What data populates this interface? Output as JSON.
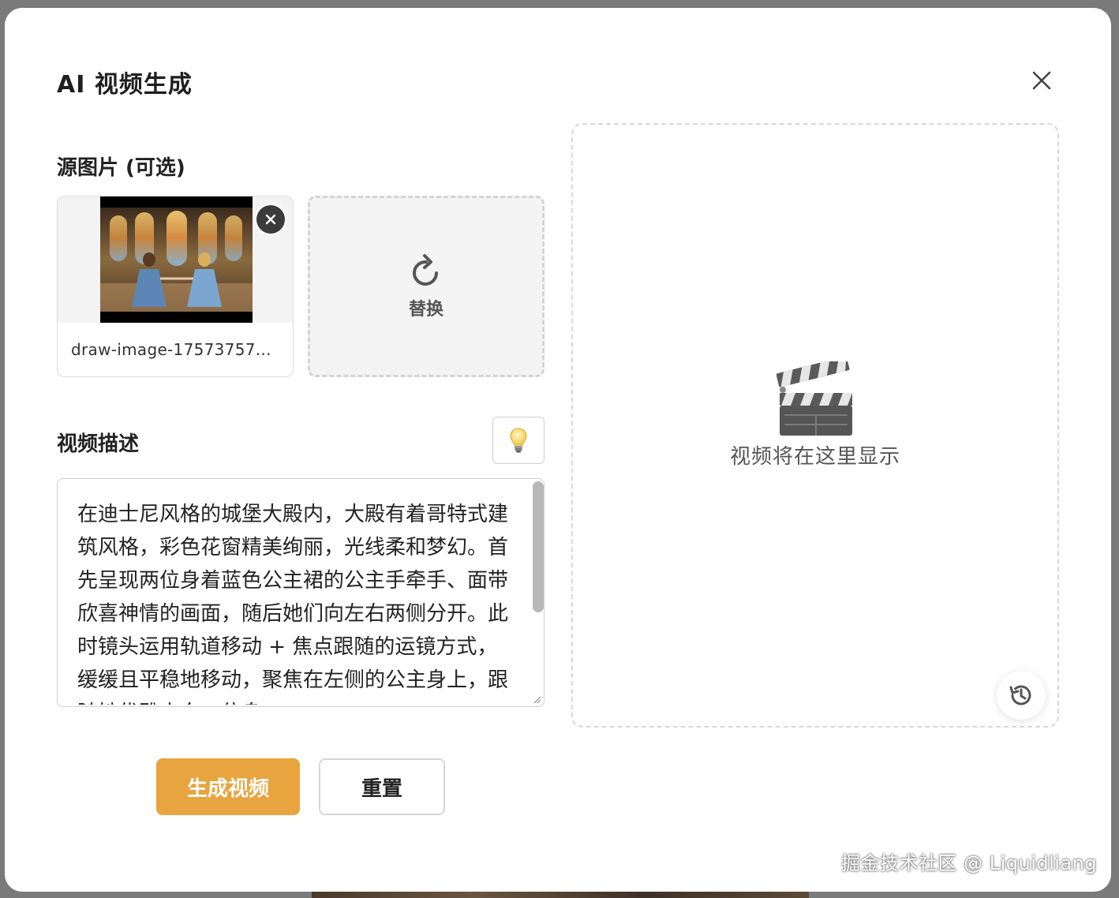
{
  "dialog": {
    "title": "AI 视频生成"
  },
  "source_image": {
    "section_label": "源图片 (可选)",
    "filename": "draw-image-17573757...",
    "replace_label": "替换"
  },
  "description": {
    "section_label": "视频描述",
    "text": "在迪士尼风格的城堡大殿内，大殿有着哥特式建筑风格，彩色花窗精美绚丽，光线柔和梦幻。首先呈现两位身着蓝色公主裙的公主手牵手、面带欣喜神情的画面，随后她们向左右两侧分开。此时镜头运用轨道移动 + 焦点跟随的运镜方式，缓缓且平稳地移动，聚焦在左侧的公主身上，跟随她优雅走向一位身"
  },
  "preview": {
    "placeholder": "视频将在这里显示"
  },
  "actions": {
    "generate_label": "生成视频",
    "reset_label": "重置"
  },
  "watermark": "掘金技术社区 @ Liquidliang",
  "icons": {
    "close": "close-icon",
    "remove": "remove-icon",
    "replace": "refresh-icon",
    "tip": "lightbulb-icon",
    "placeholder": "clapperboard-icon",
    "history": "history-icon"
  },
  "colors": {
    "primary": "#e8a43e",
    "border": "#d4d4d4",
    "text": "#222222"
  }
}
